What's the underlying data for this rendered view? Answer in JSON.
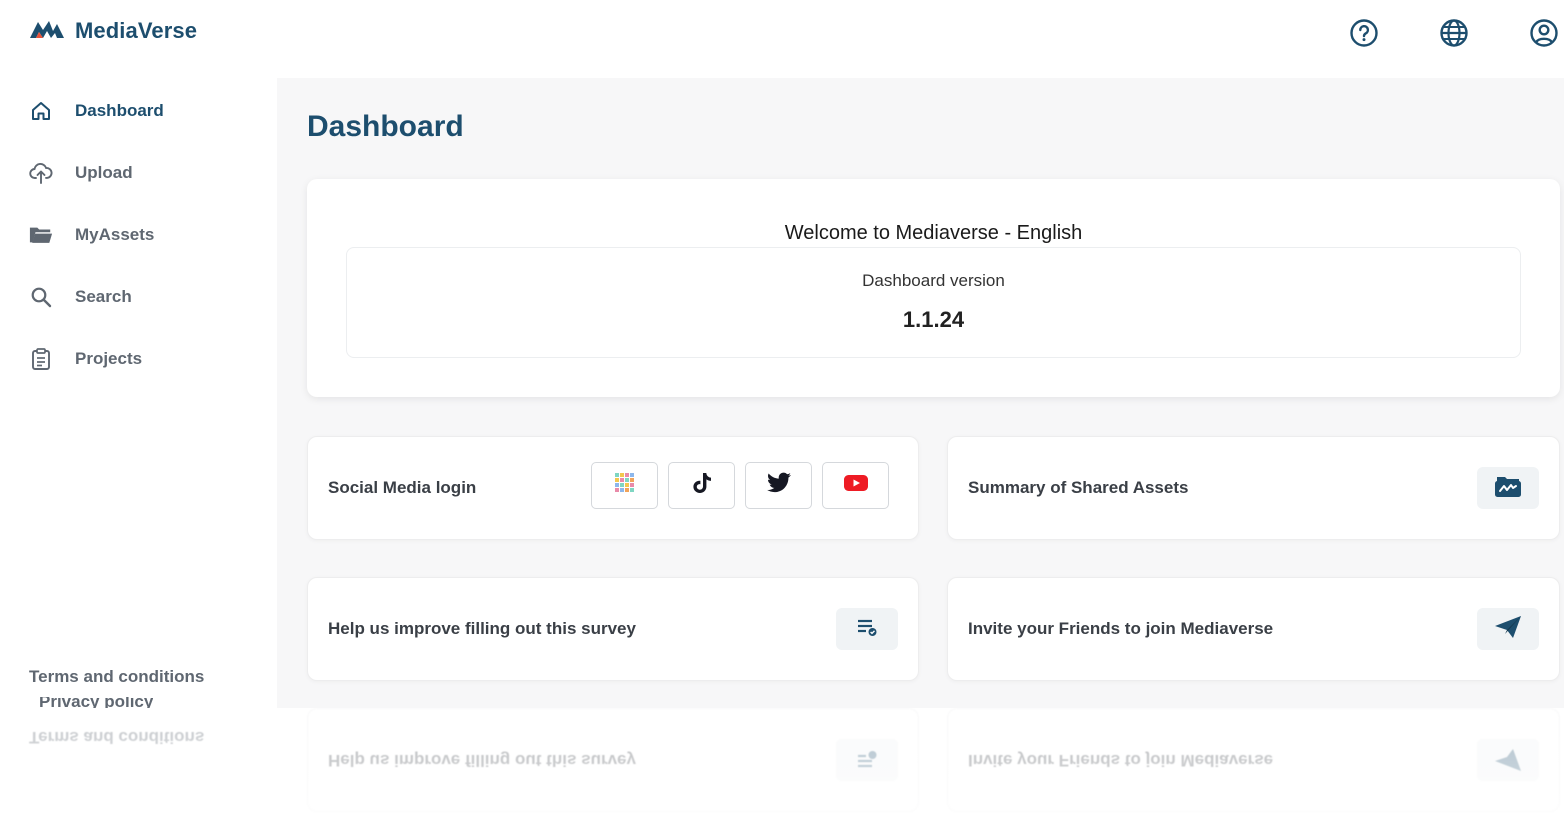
{
  "app": {
    "brand_name": "MediaVerse",
    "logo_icon": "mediaverse-logo-icon",
    "brand_color": "#1d4e6e"
  },
  "header": {
    "icons": [
      {
        "name": "help-icon"
      },
      {
        "name": "globe-icon"
      },
      {
        "name": "account-icon"
      }
    ]
  },
  "sidebar": {
    "items": [
      {
        "label": "Dashboard",
        "icon": "home-icon",
        "active": true
      },
      {
        "label": "Upload",
        "icon": "upload-cloud-icon",
        "active": false
      },
      {
        "label": "MyAssets",
        "icon": "folder-icon",
        "active": false
      },
      {
        "label": "Search",
        "icon": "search-icon",
        "active": false
      },
      {
        "label": "Projects",
        "icon": "clipboard-icon",
        "active": false
      }
    ],
    "footer": {
      "terms": "Terms and conditions",
      "privacy": "Privacy policy"
    }
  },
  "main": {
    "title": "Dashboard",
    "welcome": {
      "title": "Welcome to Mediaverse - English",
      "version_label": "Dashboard version",
      "version_value": "1.1.24"
    },
    "tiles": {
      "social": {
        "label": "Social Media login",
        "buttons": [
          {
            "name": "mediaverse-network-icon"
          },
          {
            "name": "tiktok-icon"
          },
          {
            "name": "twitter-icon"
          },
          {
            "name": "youtube-icon"
          }
        ]
      },
      "shared": {
        "label": "Summary of Shared Assets",
        "icon": "shared-assets-icon"
      },
      "survey": {
        "label": "Help us improve filling out this survey",
        "icon": "survey-icon"
      },
      "invite": {
        "label": "Invite your Friends to join Mediaverse",
        "icon": "paper-plane-icon"
      }
    }
  }
}
